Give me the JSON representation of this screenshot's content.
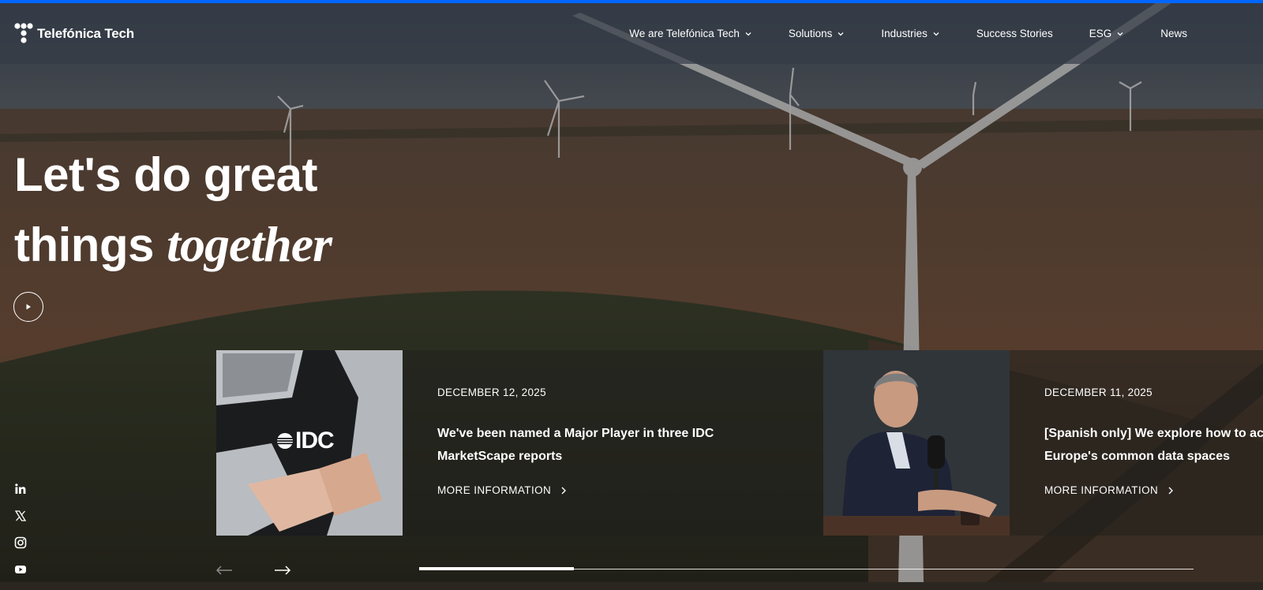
{
  "header": {
    "logo_text": "Telefónica Tech",
    "nav": [
      {
        "label": "We are Telefónica Tech",
        "has_dropdown": true
      },
      {
        "label": "Solutions",
        "has_dropdown": true
      },
      {
        "label": "Industries",
        "has_dropdown": true
      },
      {
        "label": "Success Stories",
        "has_dropdown": false
      },
      {
        "label": "ESG",
        "has_dropdown": true
      },
      {
        "label": "News",
        "has_dropdown": false
      }
    ]
  },
  "hero": {
    "headline_line1": "Let's do great",
    "headline_line2_plain": "things",
    "headline_line2_italic": "together",
    "play_icon": "play-icon"
  },
  "news": [
    {
      "date": "DECEMBER 12, 2025",
      "title_line1": "We've been named a Major Player in three IDC",
      "title_line2": "MarketScape reports",
      "more_label": "MORE INFORMATION",
      "image_logo_text": "IDC"
    },
    {
      "date": "DECEMBER 11, 2025",
      "title_line1": "[Spanish only] We explore how to ac",
      "title_line2": "Europe's common data spaces",
      "more_label": "MORE INFORMATION"
    }
  ],
  "social": [
    "linkedin-icon",
    "x-icon",
    "instagram-icon",
    "youtube-icon"
  ],
  "carousel": {
    "progress_fraction": 0.2
  },
  "colors": {
    "accent_top_bar": "#0066ff",
    "text": "#ffffff"
  }
}
